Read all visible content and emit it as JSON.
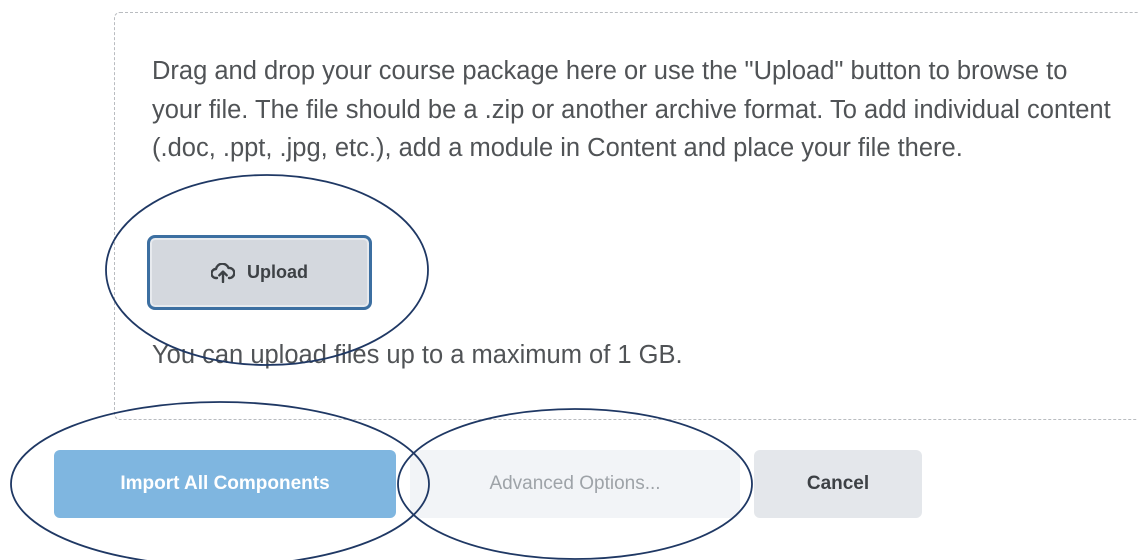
{
  "dropzone": {
    "instructions": "Drag and drop your course package here or use the \"Upload\" button to browse to your file. The file should be a .zip or another archive format. To add individual content (.doc, .ppt, .jpg, etc.), add a module in Content and place your file there.",
    "upload_label": "Upload",
    "upload_icon": "cloud-upload-icon",
    "limit_text": "You can upload files up to a maximum of 1 GB."
  },
  "actions": {
    "import_label": "Import All Components",
    "advanced_label": "Advanced Options...",
    "cancel_label": "Cancel"
  },
  "colors": {
    "annotation": "#1f3864",
    "primary": "#7fb6e0",
    "focus_border": "#3c6fa1"
  }
}
